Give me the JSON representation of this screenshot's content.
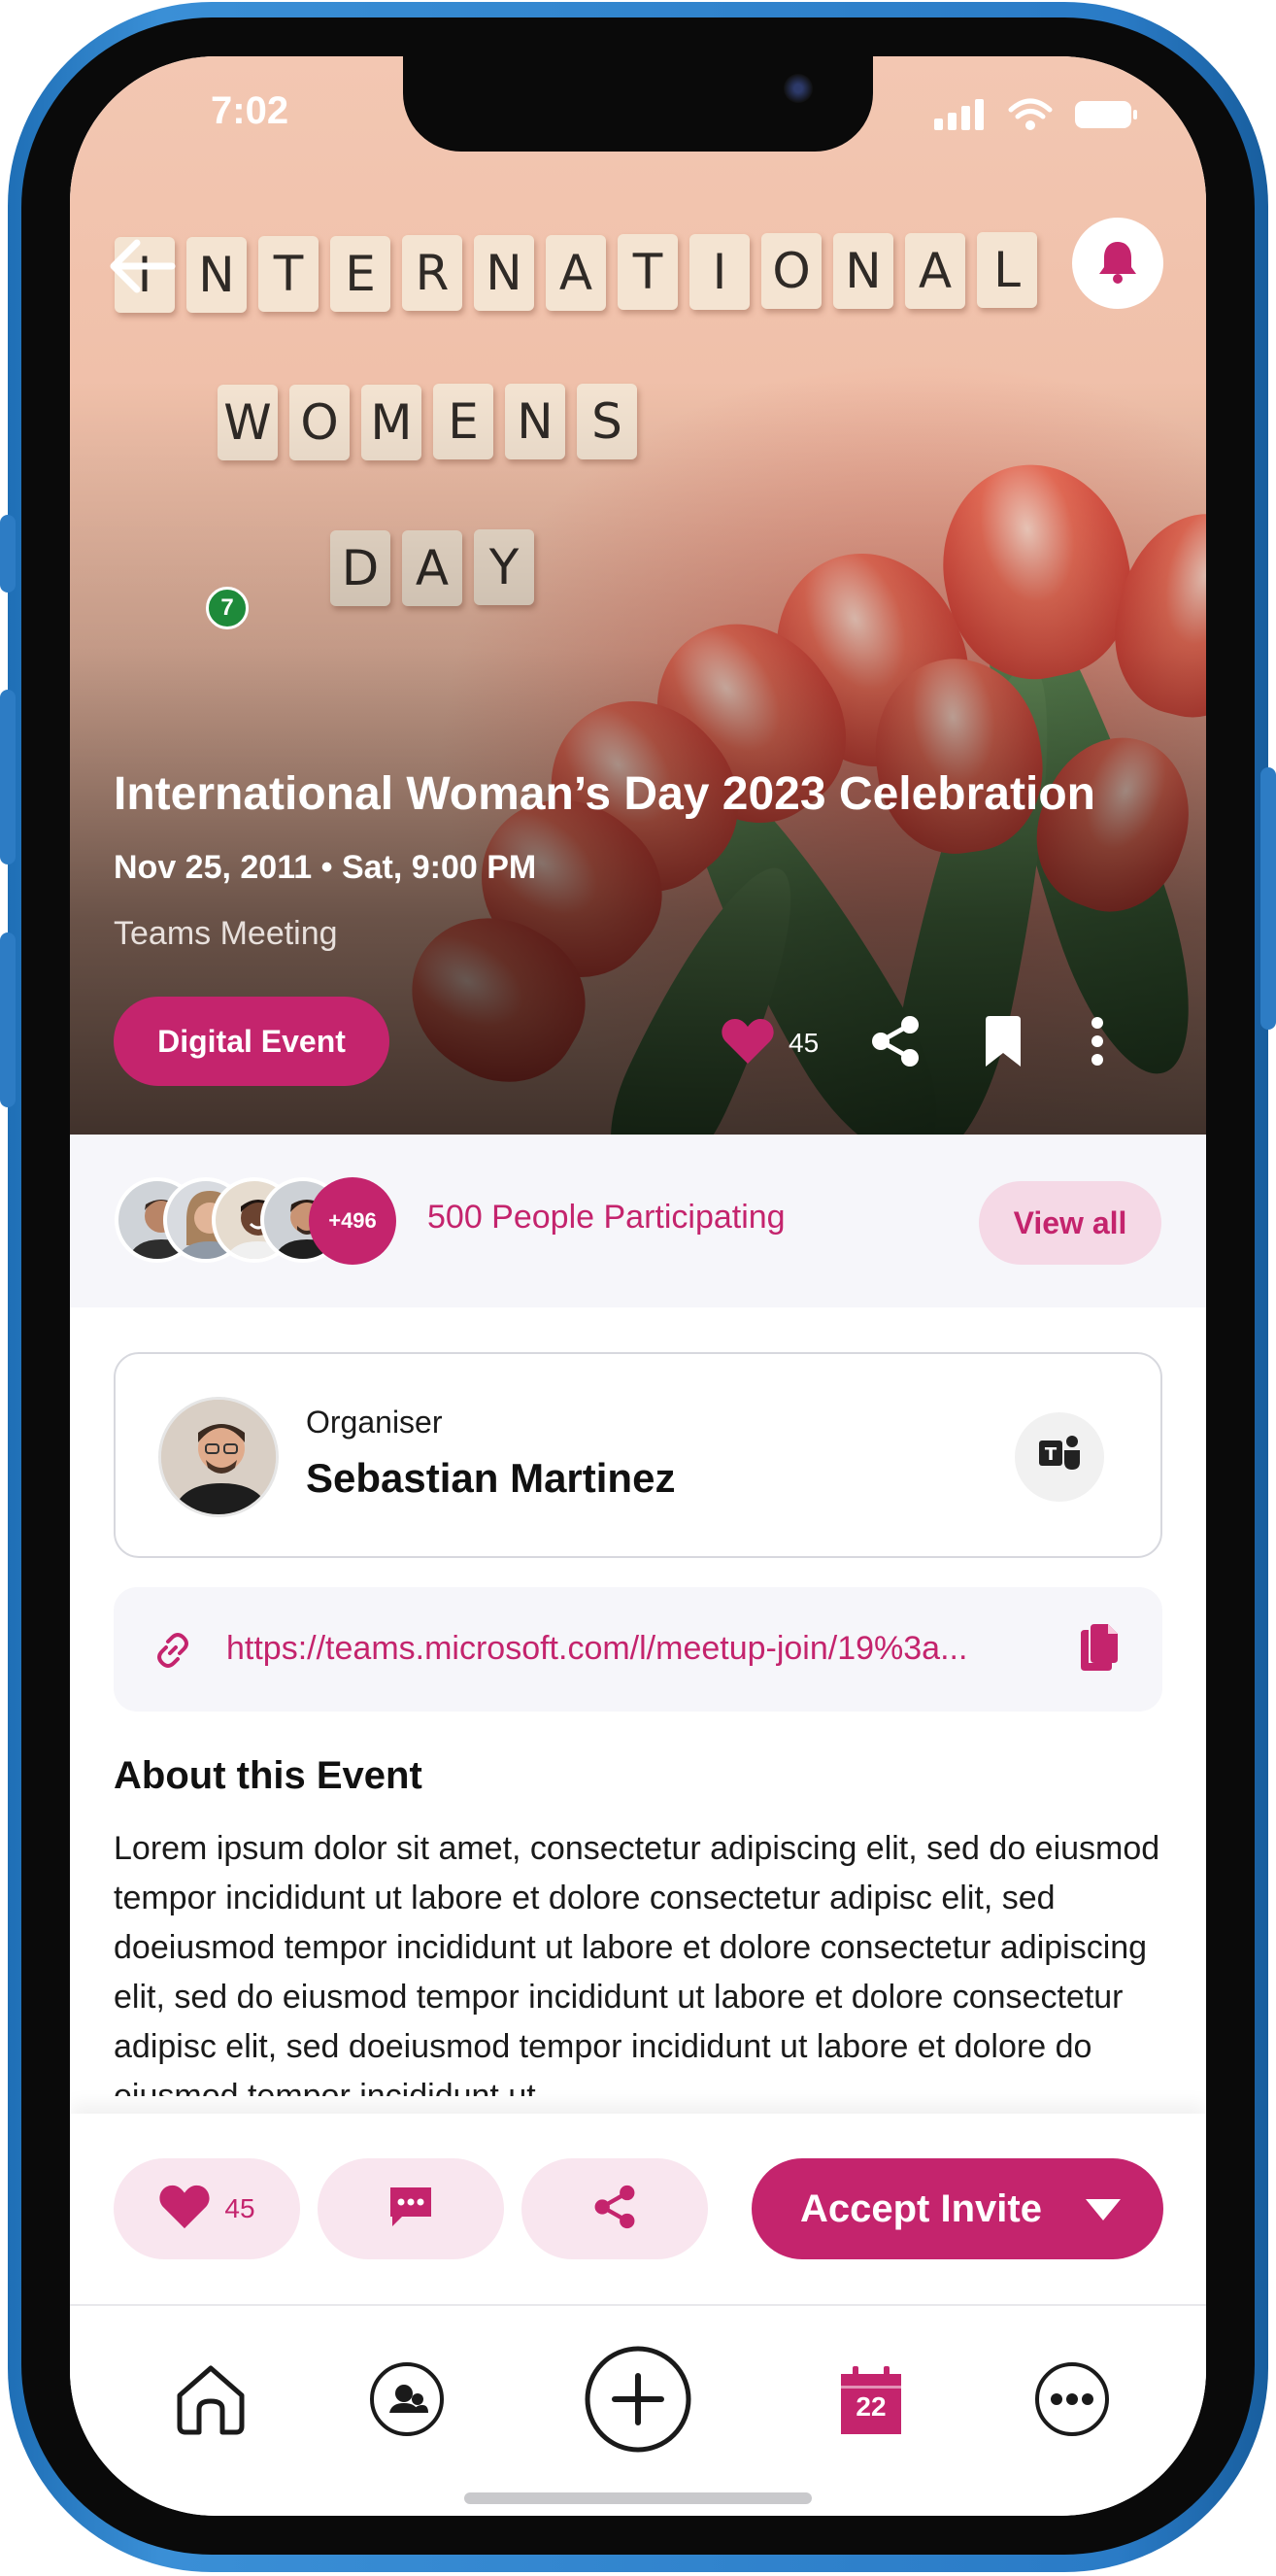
{
  "status_bar": {
    "time": "7:02"
  },
  "hero": {
    "tiles_row1": [
      "I",
      "N",
      "T",
      "E",
      "R",
      "N",
      "A",
      "T",
      "I",
      "O",
      "N",
      "A",
      "L"
    ],
    "tiles_row2": [
      "W",
      "O",
      "M",
      "E",
      "N",
      "S"
    ],
    "tiles_row3": [
      "D",
      "A",
      "Y"
    ],
    "badge": "7",
    "title": "International Woman’s Day 2023 Celebration",
    "date": "Nov 25, 2011 • Sat, 9:00 PM",
    "subtitle": "Teams Meeting",
    "event_type": "Digital Event",
    "like_count": "45"
  },
  "participants": {
    "more_count": "+496",
    "label": "500 People Participating",
    "view_all": "View all"
  },
  "organiser": {
    "role": "Organiser",
    "name": "Sebastian Martinez"
  },
  "meeting_link": {
    "url": "https://teams.microsoft.com/l/meetup-join/19%3a..."
  },
  "about": {
    "title": "About this Event",
    "body": "Lorem ipsum dolor sit amet, consectetur adipiscing elit, sed do eiusmod tempor incididunt ut labore et dolore consectetur adipisc elit, sed doeiusmod tempor incididunt ut labore et dolore consectetur adipiscing elit, sed do eiusmod tempor incididunt ut labore et dolore consectetur adipisc elit, sed doeiusmod tempor incididunt ut labore et dolore do eiusmod tempor incididunt ut"
  },
  "action_bar": {
    "like_count": "45",
    "accept_label": "Accept Invite"
  },
  "tab_bar": {
    "calendar_day": "22"
  },
  "colors": {
    "accent": "#c4246d",
    "accent_soft": "#f9e6ef",
    "frame": "#2a7bc6"
  },
  "icons": [
    "back-arrow-icon",
    "bell-icon",
    "heart-icon",
    "share-icon",
    "bookmark-icon",
    "more-vertical-icon",
    "teams-icon",
    "link-icon",
    "copy-icon",
    "chat-icon",
    "chevron-down-icon",
    "home-icon",
    "profile-icon",
    "add-icon",
    "calendar-icon",
    "more-horizontal-icon",
    "signal-icon",
    "wifi-icon",
    "battery-icon"
  ]
}
